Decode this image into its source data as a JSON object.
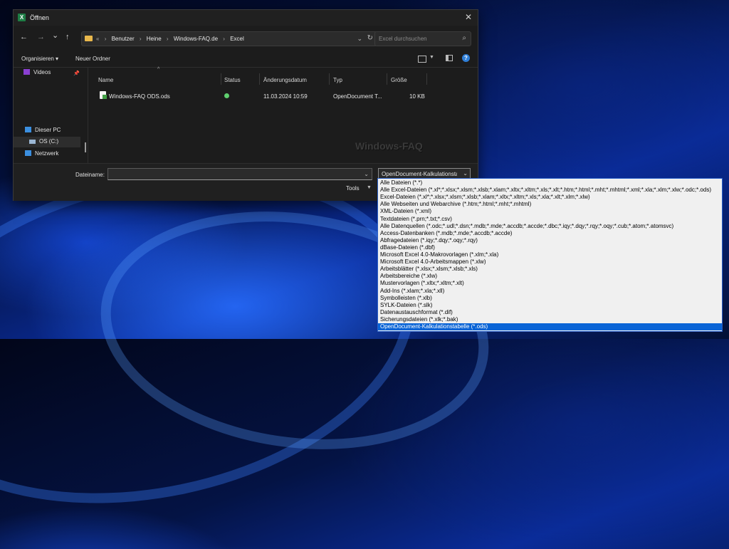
{
  "window": {
    "title": "Öffnen",
    "app_icon_letter": "X"
  },
  "nav": {
    "back": "←",
    "forward": "→",
    "recent": "⌄",
    "up": "↑",
    "breadcrumb_overflow": "«",
    "breadcrumbs": [
      "Benutzer",
      "Heine",
      "Windows-FAQ.de",
      "Excel"
    ],
    "search_placeholder": "Excel durchsuchen"
  },
  "toolbar": {
    "organize": "Organisieren ▾",
    "new_folder": "Neuer Ordner"
  },
  "sidebar": {
    "items": [
      {
        "label": "Videos",
        "icon": "video-folder-icon",
        "color": "#8a3fd1"
      },
      {
        "label": "Dieser PC",
        "icon": "computer-icon",
        "color": "#3b8fe0"
      },
      {
        "label": "OS (C:)",
        "icon": "drive-icon",
        "color": "#9bb7d4"
      },
      {
        "label": "Netzwerk",
        "icon": "network-icon",
        "color": "#3b8fe0"
      }
    ]
  },
  "columns": {
    "name": "Name",
    "status": "Status",
    "modified": "Änderungsdatum",
    "type": "Typ",
    "size": "Größe"
  },
  "files": [
    {
      "name": "Windows-FAQ ODS.ods",
      "modified": "11.03.2024 10:59",
      "type": "OpenDocument T...",
      "size": "10 KB",
      "status": "synced"
    }
  ],
  "watermark": "Windows-FAQ",
  "bottom": {
    "filename_label": "Dateiname:",
    "filename_value": "",
    "filetype_selected": "OpenDocument-Kalkulationsta",
    "tools": "Tools"
  },
  "filetype_options": [
    "Alle Dateien (*.*)",
    "Alle Excel-Dateien (*.xl*;*.xlsx;*.xlsm;*.xlsb;*.xlam;*.xltx;*.xltm;*.xls;*.xlt;*.htm;*.html;*.mht;*.mhtml;*.xml;*.xla;*.xlm;*.xlw;*.odc;*.ods)",
    "Excel-Dateien (*.xl*;*.xlsx;*.xlsm;*.xlsb;*.xlam;*.xltx;*.xltm;*.xls;*.xla;*.xlt;*.xlm;*.xlw)",
    "Alle Webseiten und Webarchive (*.htm;*.html;*.mht;*.mhtml)",
    "XML-Dateien (*.xml)",
    "Textdateien (*.prn;*.txt;*.csv)",
    "Alle Datenquellen (*.odc;*.udl;*.dsn;*.mdb;*.mde;*.accdb;*.accde;*.dbc;*.iqy;*.dqy;*.rqy;*.oqy;*.cub;*.atom;*.atomsvc)",
    "Access-Datenbanken (*.mdb;*.mde;*.accdb;*.accde)",
    "Abfragedateien (*.iqy;*.dqy;*.oqy;*.rqy)",
    "dBase-Dateien (*.dbf)",
    "Microsoft Excel 4.0-Makrovorlagen (*.xlm;*.xla)",
    "Microsoft Excel 4.0-Arbeitsmappen (*.xlw)",
    "Arbeitsblätter (*.xlsx;*.xlsm;*.xlsb;*.xls)",
    "Arbeitsbereiche (*.xlw)",
    "Mustervorlagen (*.xltx;*.xltm;*.xlt)",
    "Add-Ins (*.xlam;*.xla;*.xll)",
    "Symbolleisten (*.xlb)",
    "SYLK-Dateien (*.slk)",
    "Datenaustauschformat (*.dif)",
    "Sicherungsdateien (*.xlk;*.bak)",
    "OpenDocument-Kalkulationstabelle (*.ods)"
  ],
  "selected_option_index": 20
}
